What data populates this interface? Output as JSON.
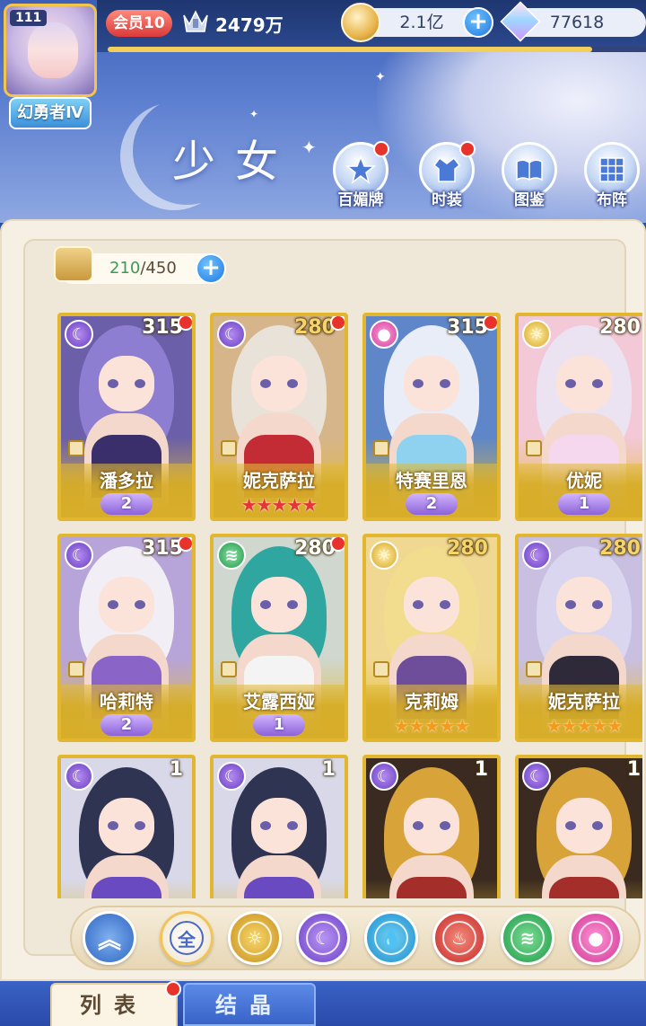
{
  "player": {
    "level": "111",
    "title": "幻勇者Ⅳ",
    "vip": "会员10",
    "power": "2479万"
  },
  "currency": {
    "coins": "2.1亿",
    "gems": "77618"
  },
  "xp_progress": 0.9,
  "page": {
    "title": "少女"
  },
  "menu": [
    {
      "label": "百媚牌",
      "icon": "star-card-icon",
      "badge": true
    },
    {
      "label": "时装",
      "icon": "outfit-icon",
      "badge": true
    },
    {
      "label": "图鉴",
      "icon": "book-icon",
      "badge": false
    },
    {
      "label": "布阵",
      "icon": "grid-formation-icon",
      "badge": false
    }
  ],
  "capacity": {
    "current": "210",
    "max": "/450"
  },
  "cards": [
    {
      "name": "潘多拉",
      "power": "315",
      "element": "moon",
      "rank": "2",
      "stars": 0,
      "star_color": "",
      "badge": true,
      "power_color": "white"
    },
    {
      "name": "妮克萨拉",
      "power": "280",
      "element": "moon",
      "rank": "",
      "stars": 5,
      "star_color": "red",
      "badge": true,
      "power_color": "gold"
    },
    {
      "name": "特赛里恩",
      "power": "315",
      "element": "pink",
      "rank": "2",
      "stars": 0,
      "star_color": "",
      "badge": true,
      "power_color": "white"
    },
    {
      "name": "优妮",
      "power": "280",
      "element": "light",
      "rank": "1",
      "stars": 0,
      "star_color": "",
      "badge": false,
      "power_color": "white"
    },
    {
      "name": "哈莉特",
      "power": "315",
      "element": "moon",
      "rank": "2",
      "stars": 0,
      "star_color": "",
      "badge": true,
      "power_color": "white"
    },
    {
      "name": "艾露西娅",
      "power": "280",
      "element": "wind",
      "rank": "1",
      "stars": 0,
      "star_color": "",
      "badge": true,
      "power_color": "white"
    },
    {
      "name": "克莉姆",
      "power": "280",
      "element": "light",
      "rank": "",
      "stars": 5,
      "star_color": "gold",
      "badge": false,
      "power_color": "gold"
    },
    {
      "name": "妮克萨拉",
      "power": "280",
      "element": "moon",
      "rank": "",
      "stars": 5,
      "star_color": "gold",
      "badge": false,
      "power_color": "gold"
    },
    {
      "name": "",
      "power": "1",
      "element": "moon",
      "rank": "",
      "stars": 0,
      "star_color": "",
      "badge": false,
      "power_color": "white"
    },
    {
      "name": "",
      "power": "1",
      "element": "moon",
      "rank": "",
      "stars": 0,
      "star_color": "",
      "badge": false,
      "power_color": "white"
    },
    {
      "name": "",
      "power": "1",
      "element": "moon",
      "rank": "",
      "stars": 0,
      "star_color": "",
      "badge": false,
      "power_color": "white"
    },
    {
      "name": "",
      "power": "1",
      "element": "moon",
      "rank": "",
      "stars": 0,
      "star_color": "",
      "badge": false,
      "power_color": "white"
    }
  ],
  "filters": [
    {
      "id": "collapse",
      "icon": "collapse-arrow-icon"
    },
    {
      "id": "all",
      "label": "全",
      "icon": "all-icon"
    },
    {
      "id": "light",
      "icon": "sun-element-icon"
    },
    {
      "id": "moon",
      "icon": "moon-element-icon"
    },
    {
      "id": "water",
      "icon": "water-element-icon"
    },
    {
      "id": "fire",
      "icon": "fire-element-icon"
    },
    {
      "id": "wind",
      "icon": "wind-element-icon"
    },
    {
      "id": "pink",
      "icon": "pink-orb-element-icon"
    }
  ],
  "tabs": {
    "list": "列表",
    "crystal": "结晶"
  },
  "colors": {
    "card_border": "#e2b62e",
    "badge_red": "#e8322c",
    "header_blue": "#3d5fb8"
  }
}
